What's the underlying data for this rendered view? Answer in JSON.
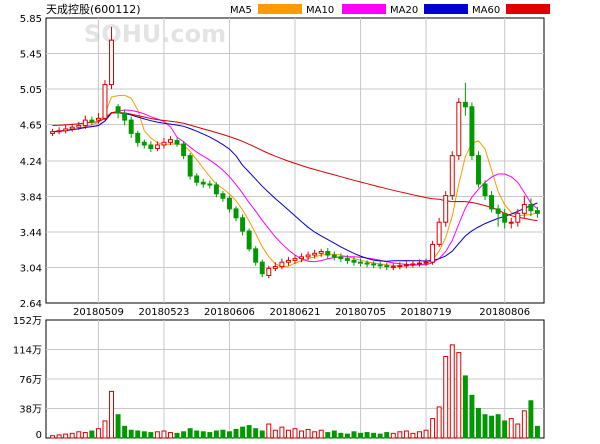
{
  "header": {
    "title": "天成控股(600112)",
    "watermark": "SOHU.com",
    "legend": [
      {
        "label": "MA5",
        "color": "#ff9900"
      },
      {
        "label": "MA10",
        "color": "#ff00ff"
      },
      {
        "label": "MA20",
        "color": "#0000cc"
      },
      {
        "label": "MA60",
        "color": "#dd0000"
      }
    ]
  },
  "colors": {
    "up": "#dd0000",
    "down": "#009900",
    "grid": "#c8c8c8",
    "axis": "#000000"
  },
  "chart_data": [
    {
      "type": "candlestick",
      "y_ticks": [
        "5.85",
        "5.45",
        "5.05",
        "4.65",
        "4.24",
        "3.84",
        "3.44",
        "3.04",
        "2.64"
      ],
      "ylim": [
        2.64,
        5.85
      ],
      "x_tick_labels": [
        "20180509",
        "20180523",
        "20180606",
        "20180621",
        "20180705",
        "20180719",
        "20180806"
      ],
      "dates": [
        "2018-04-26",
        "2018-04-27",
        "2018-05-02",
        "2018-05-03",
        "2018-05-04",
        "2018-05-07",
        "2018-05-08",
        "2018-05-09",
        "2018-05-10",
        "2018-05-11",
        "2018-05-14",
        "2018-05-15",
        "2018-05-16",
        "2018-05-17",
        "2018-05-18",
        "2018-05-21",
        "2018-05-22",
        "2018-05-23",
        "2018-05-24",
        "2018-05-25",
        "2018-05-28",
        "2018-05-29",
        "2018-05-30",
        "2018-05-31",
        "2018-06-01",
        "2018-06-04",
        "2018-06-05",
        "2018-06-06",
        "2018-06-07",
        "2018-06-08",
        "2018-06-11",
        "2018-06-12",
        "2018-06-13",
        "2018-06-14",
        "2018-06-15",
        "2018-06-19",
        "2018-06-20",
        "2018-06-21",
        "2018-06-22",
        "2018-06-25",
        "2018-06-26",
        "2018-06-27",
        "2018-06-28",
        "2018-06-29",
        "2018-07-02",
        "2018-07-03",
        "2018-07-04",
        "2018-07-05",
        "2018-07-06",
        "2018-07-09",
        "2018-07-10",
        "2018-07-11",
        "2018-07-12",
        "2018-07-13",
        "2018-07-16",
        "2018-07-17",
        "2018-07-18",
        "2018-07-19",
        "2018-07-20",
        "2018-07-23",
        "2018-07-24",
        "2018-07-25",
        "2018-07-26",
        "2018-07-27",
        "2018-07-30",
        "2018-07-31",
        "2018-08-01",
        "2018-08-02",
        "2018-08-03",
        "2018-08-06",
        "2018-08-07",
        "2018-08-08",
        "2018-08-09",
        "2018-08-10",
        "2018-08-13"
      ],
      "open": [
        4.55,
        4.57,
        4.58,
        4.6,
        4.62,
        4.64,
        4.7,
        4.7,
        4.72,
        5.1,
        4.85,
        4.78,
        4.7,
        4.55,
        4.45,
        4.42,
        4.38,
        4.42,
        4.45,
        4.47,
        4.43,
        4.3,
        4.07,
        4.0,
        3.98,
        3.97,
        3.87,
        3.82,
        3.7,
        3.6,
        3.45,
        3.25,
        3.1,
        2.95,
        3.03,
        3.05,
        3.1,
        3.12,
        3.14,
        3.16,
        3.18,
        3.2,
        3.22,
        3.18,
        3.16,
        3.14,
        3.12,
        3.1,
        3.09,
        3.08,
        3.07,
        3.06,
        3.05,
        3.05,
        3.06,
        3.07,
        3.08,
        3.09,
        3.1,
        3.3,
        3.55,
        3.85,
        4.3,
        4.9,
        4.85,
        4.3,
        3.98,
        3.85,
        3.7,
        3.65,
        3.55,
        3.55,
        3.65,
        3.75,
        3.68
      ],
      "close": [
        4.57,
        4.58,
        4.6,
        4.62,
        4.64,
        4.7,
        4.68,
        4.72,
        5.1,
        5.6,
        4.78,
        4.7,
        4.55,
        4.45,
        4.42,
        4.38,
        4.42,
        4.45,
        4.48,
        4.43,
        4.3,
        4.07,
        4.0,
        3.98,
        3.97,
        3.87,
        3.82,
        3.7,
        3.6,
        3.45,
        3.25,
        3.1,
        2.97,
        3.03,
        3.05,
        3.1,
        3.12,
        3.14,
        3.16,
        3.18,
        3.2,
        3.22,
        3.18,
        3.16,
        3.14,
        3.12,
        3.1,
        3.09,
        3.08,
        3.07,
        3.06,
        3.05,
        3.05,
        3.06,
        3.07,
        3.08,
        3.09,
        3.1,
        3.3,
        3.55,
        3.85,
        4.3,
        4.9,
        4.85,
        4.3,
        3.98,
        3.85,
        3.7,
        3.65,
        3.55,
        3.55,
        3.65,
        3.75,
        3.68,
        3.65
      ],
      "high": [
        4.6,
        4.62,
        4.65,
        4.66,
        4.68,
        4.75,
        4.74,
        4.78,
        5.15,
        5.75,
        4.88,
        4.82,
        4.74,
        4.58,
        4.48,
        4.46,
        4.46,
        4.5,
        4.52,
        4.5,
        4.46,
        4.33,
        4.1,
        4.04,
        4.02,
        4.0,
        3.9,
        3.85,
        3.73,
        3.64,
        3.48,
        3.28,
        3.13,
        3.06,
        3.1,
        3.14,
        3.16,
        3.18,
        3.2,
        3.22,
        3.24,
        3.25,
        3.26,
        3.22,
        3.2,
        3.18,
        3.16,
        3.14,
        3.12,
        3.11,
        3.1,
        3.09,
        3.09,
        3.1,
        3.11,
        3.12,
        3.13,
        3.14,
        3.34,
        3.6,
        3.9,
        4.35,
        4.95,
        5.12,
        4.9,
        4.35,
        4.02,
        3.9,
        3.75,
        3.7,
        3.6,
        3.7,
        3.85,
        3.82,
        3.72
      ],
      "low": [
        4.52,
        4.54,
        4.55,
        4.57,
        4.59,
        4.6,
        4.64,
        4.66,
        4.7,
        5.05,
        4.72,
        4.64,
        4.5,
        4.4,
        4.38,
        4.34,
        4.35,
        4.38,
        4.42,
        4.4,
        4.26,
        4.03,
        3.96,
        3.94,
        3.93,
        3.83,
        3.78,
        3.66,
        3.56,
        3.4,
        3.22,
        3.06,
        2.93,
        2.92,
        3.0,
        3.02,
        3.06,
        3.08,
        3.1,
        3.12,
        3.14,
        3.16,
        3.14,
        3.12,
        3.1,
        3.08,
        3.06,
        3.05,
        3.04,
        3.03,
        3.02,
        3.01,
        3.01,
        3.02,
        3.03,
        3.04,
        3.05,
        3.06,
        3.07,
        3.27,
        3.5,
        3.8,
        4.25,
        4.75,
        4.25,
        3.94,
        3.8,
        3.66,
        3.5,
        3.48,
        3.48,
        3.5,
        3.6,
        3.62,
        3.6
      ],
      "moving_averages": [
        "MA5",
        "MA10",
        "MA20",
        "MA60"
      ]
    },
    {
      "type": "bar",
      "y_ticks": [
        "152万",
        "114万",
        "76万",
        "38万",
        "0"
      ],
      "ylim": [
        0,
        152
      ],
      "unit": "万",
      "values": [
        3,
        4,
        5,
        6,
        8,
        7,
        9,
        12,
        22,
        60,
        30,
        15,
        10,
        9,
        8,
        7,
        8,
        9,
        7,
        6,
        8,
        12,
        9,
        8,
        7,
        9,
        10,
        8,
        11,
        14,
        16,
        12,
        9,
        18,
        10,
        14,
        10,
        12,
        9,
        11,
        8,
        10,
        7,
        9,
        6,
        5,
        8,
        6,
        7,
        6,
        5,
        7,
        6,
        8,
        9,
        6,
        8,
        10,
        25,
        40,
        105,
        120,
        110,
        80,
        55,
        38,
        30,
        28,
        30,
        22,
        25,
        18,
        35,
        48,
        15
      ]
    }
  ]
}
